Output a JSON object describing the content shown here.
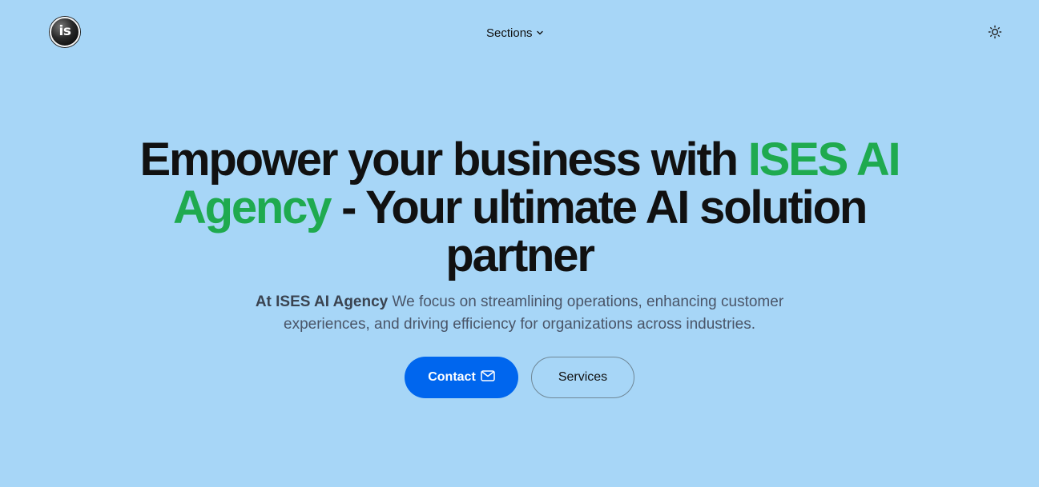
{
  "header": {
    "logo_text": "is",
    "nav_label": "Sections"
  },
  "hero": {
    "title_part1": "Empower your business with ",
    "title_accent": "ISES AI Agency",
    "title_part2": " - Your ultimate AI solution partner",
    "subtitle_strong": "At ISES AI Agency",
    "subtitle_rest": " We focus on streamlining operations, enhancing customer experiences, and driving efficiency for organizations across industries."
  },
  "actions": {
    "contact_label": "Contact",
    "services_label": "Services"
  },
  "colors": {
    "background": "#a7d6f7",
    "accent_green": "#1faa4f",
    "primary_blue": "#0066ee",
    "text_dark": "#111111",
    "text_muted": "#4a5568"
  },
  "icons": {
    "logo": "is-logo",
    "nav": "chevron-down-icon",
    "theme": "sun-icon",
    "contact": "mail-icon"
  }
}
